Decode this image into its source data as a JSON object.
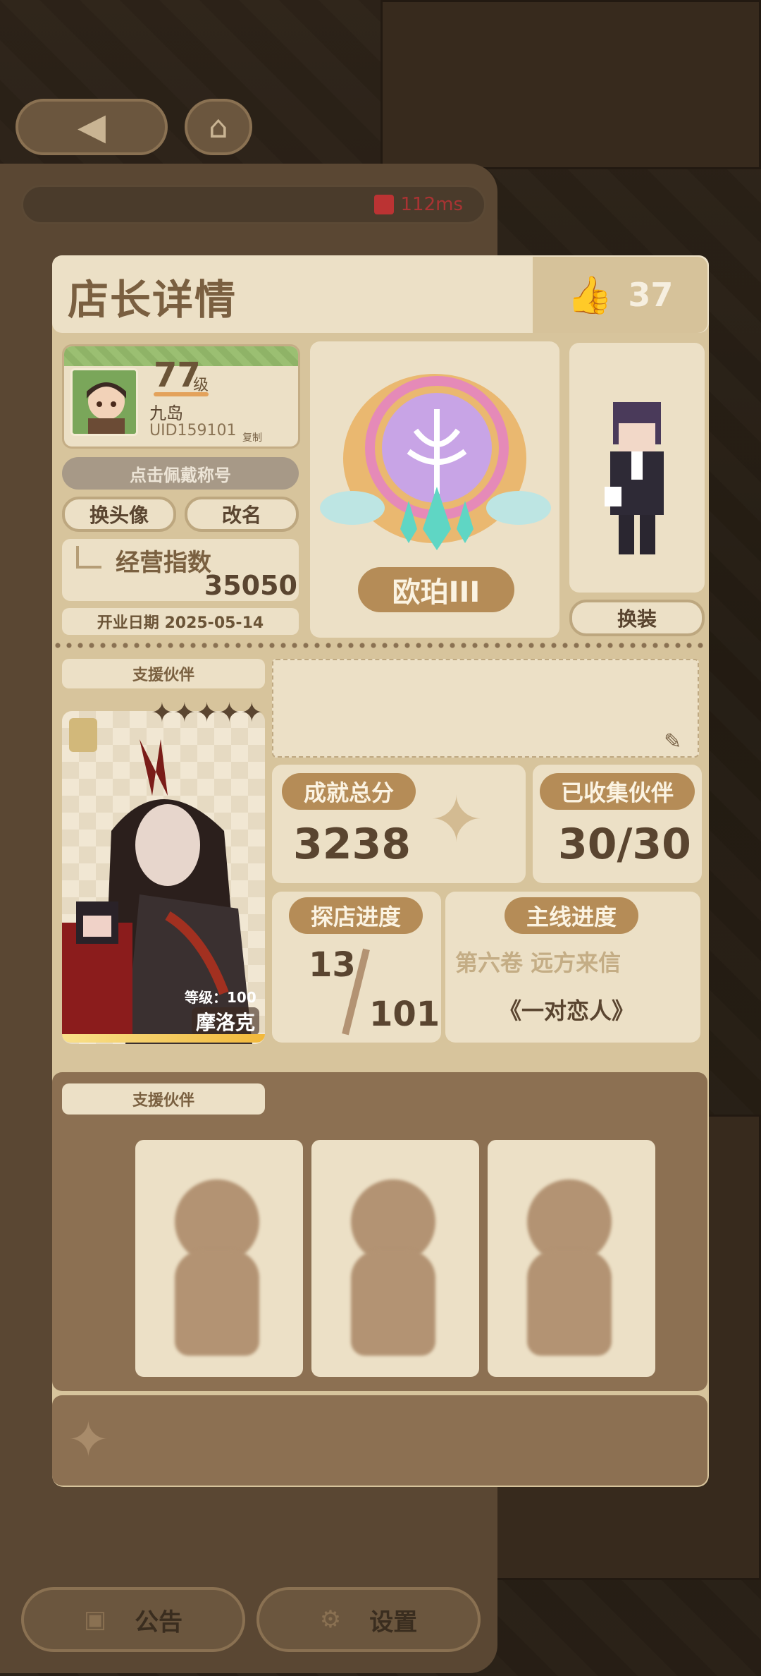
{
  "hud": {
    "ping": "112ms"
  },
  "panel": {
    "title": "店长详情",
    "likes": "37"
  },
  "profile": {
    "level": "77",
    "level_unit": "级",
    "name": "九岛",
    "uid": "UID159101",
    "copy_label": "复制",
    "title_button": "点击佩戴称号",
    "change_avatar": "换头像",
    "rename": "改名",
    "business_label": "经营指数",
    "business_value": "35050",
    "open_date": "开业日期 2025-05-14"
  },
  "badge": {
    "name": "欧珀III"
  },
  "outfit": {
    "button": "换装"
  },
  "support": {
    "label": "支援伙伴",
    "partner_level": "等级：100",
    "partner_name": "摩洛克",
    "stars": "✦✦✦✦✦"
  },
  "stats": {
    "achievement_label": "成就总分",
    "achievement_value": "3238",
    "collected_label": "已收集伙伴",
    "collected_value": "30/30",
    "explore_label": "探店进度",
    "explore_current": "13",
    "explore_total": "101",
    "story_label": "主线进度",
    "story_chapter": "第六卷 远方来信",
    "story_title": "《一对恋人》"
  },
  "support2": {
    "label": "支援伙伴"
  },
  "bottom": {
    "notice": "公告",
    "settings": "设置"
  }
}
